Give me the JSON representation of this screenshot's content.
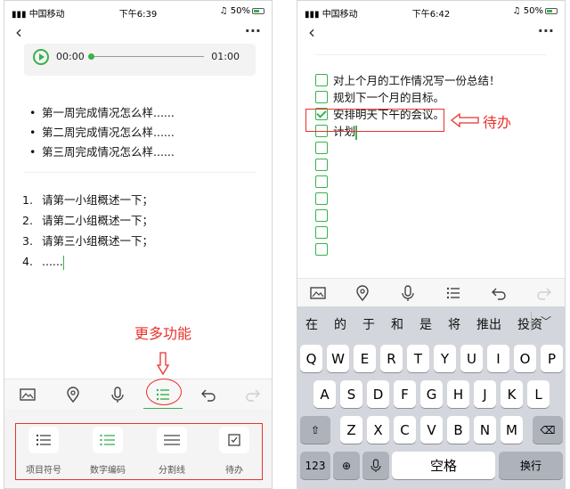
{
  "left_screen": {
    "status": {
      "carrier": "中国移动",
      "time": "下午6:39",
      "battery": "50%"
    },
    "audio": {
      "start": "00:00",
      "end": "01:00"
    },
    "bullets": [
      "第一周完成情况怎么样......",
      "第二周完成情况怎么样......",
      "第三周完成情况怎么样......"
    ],
    "numbered": [
      {
        "num": "1.",
        "text": "请第一小组概述一下；"
      },
      {
        "num": "2.",
        "text": "请第二小组概述一下；"
      },
      {
        "num": "3.",
        "text": "请第三小组概述一下；"
      },
      {
        "num": "4.",
        "text": "......"
      }
    ],
    "annotation": "更多功能",
    "panel_items": [
      "项目符号",
      "数字编码",
      "分割线",
      "待办"
    ]
  },
  "right_screen": {
    "status": {
      "carrier": "中国移动",
      "time": "下午6:42",
      "battery": "50%"
    },
    "todos": [
      {
        "text": "对上个月的工作情况写一份总结！",
        "checked": false
      },
      {
        "text": "规划下一个月的目标。",
        "checked": false
      },
      {
        "text": "安排明天下午的会议。",
        "checked": true
      },
      {
        "text": "计划",
        "checked": false
      },
      {
        "text": "",
        "checked": false
      },
      {
        "text": "",
        "checked": false
      },
      {
        "text": "",
        "checked": false
      },
      {
        "text": "",
        "checked": false
      },
      {
        "text": "",
        "checked": false
      },
      {
        "text": "",
        "checked": false
      },
      {
        "text": "",
        "checked": false
      },
      {
        "text": "",
        "checked": false
      }
    ],
    "annotation": "待办",
    "suggestions": [
      "在",
      "的",
      "于",
      "和",
      "是",
      "将",
      "推出",
      "投资"
    ],
    "keyboard": {
      "row1": [
        "Q",
        "W",
        "E",
        "R",
        "T",
        "Y",
        "U",
        "I",
        "O",
        "P"
      ],
      "row2": [
        "A",
        "S",
        "D",
        "F",
        "G",
        "H",
        "J",
        "K",
        "L"
      ],
      "row3": [
        "Z",
        "X",
        "C",
        "V",
        "B",
        "N",
        "M"
      ],
      "num_key": "123",
      "space": "空格",
      "enter": "换行"
    }
  },
  "colors": {
    "accent": "#37b24d",
    "annotation": "#e8322c"
  }
}
